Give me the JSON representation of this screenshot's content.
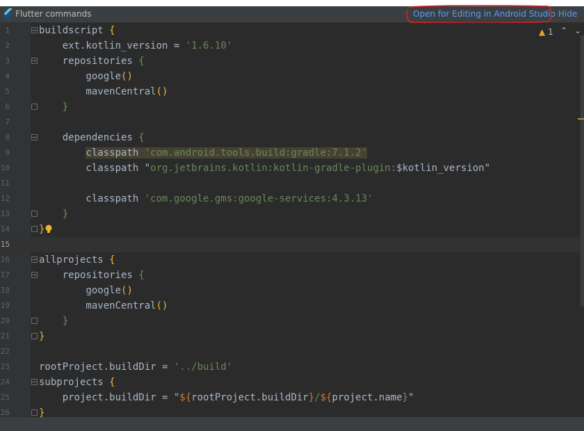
{
  "notification": {
    "title": "Flutter commands",
    "open_link": "Open for Editing in Android Studio",
    "hide_link": "Hide"
  },
  "inspection": {
    "warning_count": "1"
  },
  "editor": {
    "current_line": 15,
    "lines": [
      {
        "n": "1",
        "html": "buildscript <span class='br'>{</span>"
      },
      {
        "n": "2",
        "html": "    ext.kotlin_version = <span class='str'>'1.6.10'</span>"
      },
      {
        "n": "3",
        "html": "    repositories <span class='br2'>{</span>"
      },
      {
        "n": "4",
        "html": "        google<span class='par'>()</span>"
      },
      {
        "n": "5",
        "html": "        mavenCentral<span class='par'>()</span>"
      },
      {
        "n": "6",
        "html": "    <span class='br2'>}</span>"
      },
      {
        "n": "7",
        "html": ""
      },
      {
        "n": "8",
        "html": "    dependencies <span class='br2'>{</span>"
      },
      {
        "n": "9",
        "html": "        <span class='hl'>classpath <span class='str'>'com.android.tools.build:gradle:7.1.2'</span></span>"
      },
      {
        "n": "10",
        "html": "        classpath \"<span class='str'>org.jetbrains.kotlin:kotlin-gradle-plugin:</span>$kotlin_version\""
      },
      {
        "n": "11",
        "html": ""
      },
      {
        "n": "12",
        "html": "        classpath <span class='str'>'com.google.gms:google-services:4.3.13'</span>"
      },
      {
        "n": "13",
        "html": "    <span class='br2'>}</span>"
      },
      {
        "n": "14",
        "html": "<span class='br'>}</span>"
      },
      {
        "n": "15",
        "html": ""
      },
      {
        "n": "16",
        "html": "allprojects <span class='br'>{</span>"
      },
      {
        "n": "17",
        "html": "    repositories <span class='br2'>{</span>"
      },
      {
        "n": "18",
        "html": "        google<span class='par'>()</span>"
      },
      {
        "n": "19",
        "html": "        mavenCentral<span class='par'>()</span>"
      },
      {
        "n": "20",
        "html": "    <span class='br2'>}</span>"
      },
      {
        "n": "21",
        "html": "<span class='br'>}</span>"
      },
      {
        "n": "22",
        "html": ""
      },
      {
        "n": "23",
        "html": "rootProject.buildDir = <span class='str'>'../build'</span>"
      },
      {
        "n": "24",
        "html": "subprojects <span class='br'>{</span>"
      },
      {
        "n": "25",
        "html": "    project.buildDir = \"<span class='tmpl'>${</span>rootProject.buildDir<span class='tmpl'>}</span><span class='str'>/</span><span class='tmpl'>${</span>project.name<span class='tmpl'>}</span>\""
      },
      {
        "n": "26",
        "html": "<span class='br'>}</span>"
      }
    ],
    "fold_open": [
      1,
      3,
      8,
      16,
      17,
      24
    ],
    "fold_close": [
      6,
      13,
      14,
      20,
      21,
      26
    ],
    "bulb_line": 14
  },
  "colors": {
    "background": "#2b2b2b",
    "link": "#589df6",
    "string": "#6a8759",
    "brace": "#e8ba36",
    "annotation": "#e02020"
  }
}
